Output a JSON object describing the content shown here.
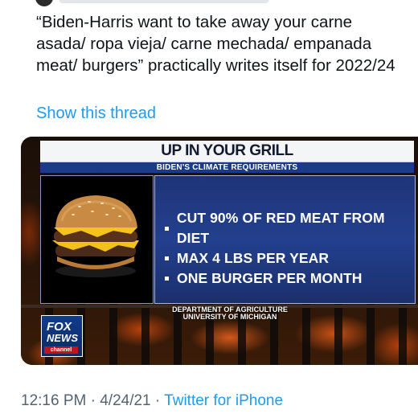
{
  "tweet": {
    "text": "“Biden-Harris want to take away your carne asada/ ropa vieja/ carne mechada/ empanada meat/ burgers” practically writes itself for 2022/24",
    "show_thread": "Show this thread",
    "time": "12:16 PM",
    "separator": "·",
    "date": "4/24/21",
    "source": "Twitter for iPhone"
  },
  "media": {
    "headline": "UP IN YOUR GRILL",
    "subhead": "BIDEN'S CLIMATE REQUIREMENTS",
    "facts": [
      "CUT 90% OF RED MEAT FROM DIET",
      "MAX 4 LBS PER YEAR",
      "ONE BURGER PER MONTH"
    ],
    "source_line1": "DEPARTMENT OF AGRICULTURE",
    "source_line2": "UNIVERSITY OF MICHIGAN",
    "logo": {
      "fox": "FOX",
      "news": "NEWS",
      "channel": "channel"
    }
  },
  "colors": {
    "link": "#1d9bf0",
    "text": "#0f1419",
    "meta": "#536471",
    "graphic_blue": "#23408e"
  }
}
